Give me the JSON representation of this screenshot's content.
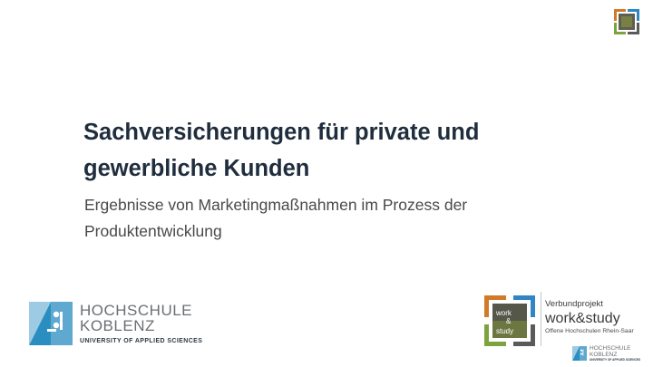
{
  "slide": {
    "title_lines": [
      "Sachversicherungen für private und",
      "gewerbliche Kunden"
    ],
    "subtitle_lines": [
      "Ergebnisse von Marketingmaßnahmen im Prozess der",
      "Produktentwicklung"
    ]
  },
  "logo_hochschule": {
    "name_line1": "HOCHSCHULE",
    "name_line2": "KOBLENZ",
    "tagline": "UNIVERSITY OF APPLIED SCIENCES"
  },
  "logo_workstudy": {
    "mark_word1": "work",
    "mark_word2": "&",
    "mark_word3": "study",
    "project_label": "Verbundprojekt",
    "brand_name": "work&study",
    "tagline": "Offene Hochschulen Rhein-Saar",
    "small_hk_line1": "HOCHSCHULE",
    "small_hk_line2": "KOBLENZ",
    "small_hk_tagline": "UNIVERSITY OF APPLIED SCIENCES"
  },
  "colors": {
    "title": "#1f2d3d",
    "subtitle": "#4a4a4a",
    "hk_blue": "#2a8fc0",
    "ws_orange": "#d27a2a",
    "ws_green": "#7da33e",
    "ws_blue": "#2f86c2",
    "ws_grey": "#5a5a5a"
  }
}
